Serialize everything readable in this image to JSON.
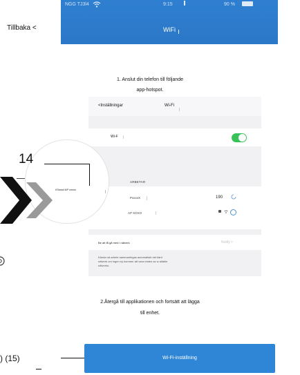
{
  "status_bar": {
    "carrier": "NGG TJ3l4",
    "time": "9:15",
    "battery": "90 %"
  },
  "header": {
    "back_label": "Tillbaka <",
    "title": "WiFi"
  },
  "instructions": {
    "step1_line1": "1. Anslut din telefon till följande",
    "step1_line2": "app-hotspot.",
    "step2_line1": "2.Återgå till applikationen och fortsätt att lägga",
    "step2_line2": "till enhet."
  },
  "settings_screenshot": {
    "back_label": "<Inställningar",
    "title": "Wi-Fi",
    "wifi_label": "Wi-F",
    "working_header": "ARBETAR",
    "networks": [
      {
        "name": "PxxxxX",
        "value": "190"
      },
      {
        "name": "AP XOXO"
      }
    ],
    "ask_label": "Be att få gå med i nätverk",
    "ask_value": "Notify >",
    "footnote_line1": "Kända nä arbete sammanfogas automatiskt det känt",
    "footnote_line2": "nätverk om ingen ey kommer att vara resten av w allable",
    "footnote_line3": "nätverks.",
    "magnifier_network_name": "I/Smart AP xxxxx"
  },
  "callouts": {
    "c14": "14",
    "c15": ") (15)"
  },
  "button": {
    "label": "Wi-Fi-inställning"
  },
  "colors": {
    "header_blue": "#2f7fd1",
    "button_blue": "#2f86d6",
    "toggle_green": "#38c35a",
    "chevron_dark": "#111111",
    "chevron_gray": "#9a9a9a"
  }
}
